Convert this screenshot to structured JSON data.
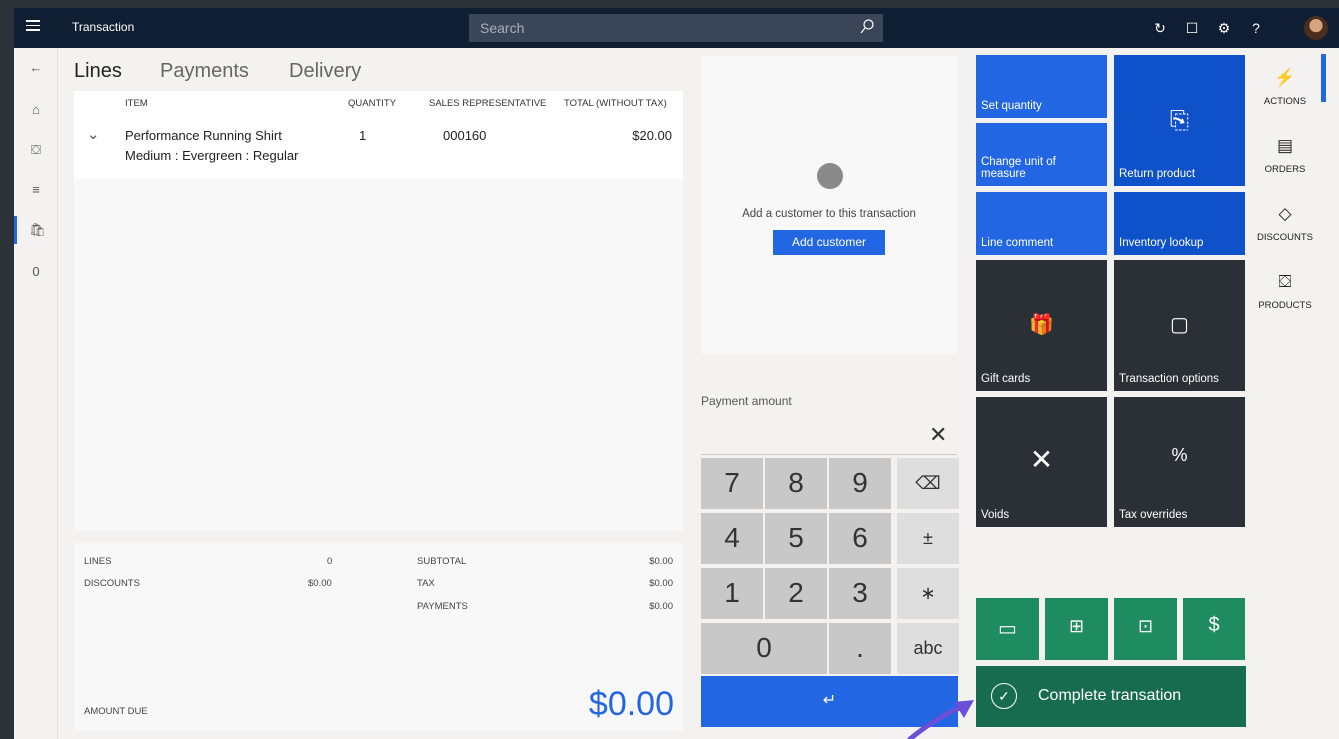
{
  "topbar": {
    "title": "Transaction",
    "search_placeholder": "Search"
  },
  "tabs": [
    "Lines",
    "Payments",
    "Delivery"
  ],
  "lines": {
    "columns": [
      "ITEM",
      "QUANTITY",
      "SALES REPRESENTATIVE",
      "TOTAL (WITHOUT TAX)"
    ],
    "rows": [
      {
        "item": "Performance Running Shirt",
        "variant": "Medium : Evergreen : Regular",
        "quantity": "1",
        "rep": "000160",
        "total": "$20.00"
      }
    ]
  },
  "rail": {
    "badge_count": "0"
  },
  "totals": {
    "lines_label": "LINES",
    "lines_value": "0",
    "discounts_label": "DISCOUNTS",
    "discounts_value": "$0.00",
    "subtotal_label": "SUBTOTAL",
    "subtotal_value": "$0.00",
    "tax_label": "TAX",
    "tax_value": "$0.00",
    "payments_label": "PAYMENTS",
    "payments_value": "$0.00",
    "amount_due_label": "AMOUNT DUE",
    "amount_due_value": "$0.00"
  },
  "customer": {
    "prompt": "Add a customer to this transaction",
    "button": "Add customer"
  },
  "keypad": {
    "label": "Payment amount",
    "keys": [
      "7",
      "8",
      "9",
      "⌫",
      "4",
      "5",
      "6",
      "±",
      "1",
      "2",
      "3",
      "∗",
      "0",
      ".",
      "abc"
    ],
    "enter": "↵"
  },
  "tiles": {
    "set_quantity": "Set quantity",
    "change_uom": "Change unit of measure",
    "return_product": "Return product",
    "line_comment": "Line comment",
    "inventory_lookup": "Inventory lookup",
    "gift_cards": "Gift cards",
    "transaction_options": "Transaction options",
    "voids": "Voids",
    "tax_overrides": "Tax overrides"
  },
  "right_rail": [
    "ACTIONS",
    "ORDERS",
    "DISCOUNTS",
    "PRODUCTS"
  ],
  "complete": {
    "label": "Complete transation"
  },
  "colors": {
    "accent": "#2266e3",
    "topbar": "#0f1e33",
    "tile_dark": "#2b2f36",
    "tile_green": "#1f8b60"
  }
}
